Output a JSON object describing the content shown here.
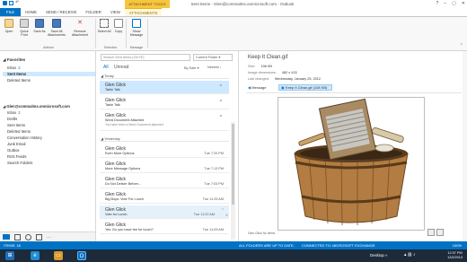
{
  "window": {
    "title": "Sent Items - Glen@commalms.onmicrosoft.com - Outlook",
    "context_header": "ATTACHMENT TOOLS"
  },
  "ribbon_tabs": [
    "FILE",
    "HOME",
    "SEND / RECEIVE",
    "FOLDER",
    "VIEW",
    "ATTACHMENTS"
  ],
  "ribbon": {
    "buttons": [
      {
        "label": "Open",
        "icon": "open-icon"
      },
      {
        "label": "Quick Print",
        "icon": "print-icon"
      },
      {
        "label": "Save As",
        "icon": "save-as-icon"
      },
      {
        "label": "Save All Attachments",
        "icon": "save-all-icon"
      },
      {
        "label": "Remove Attachment",
        "icon": "remove-attachment-icon"
      },
      {
        "label": "Select All",
        "icon": "select-all-icon"
      },
      {
        "label": "Copy",
        "icon": "copy-icon"
      },
      {
        "label": "Show Message",
        "icon": "show-message-icon"
      }
    ],
    "groups": [
      "Actions",
      "Selection",
      "Message"
    ]
  },
  "folders": {
    "favorites_label": "Favorites",
    "favorites": [
      {
        "label": "Inbox",
        "count": "2"
      },
      {
        "label": "Sent Items",
        "count": ""
      },
      {
        "label": "Deleted Items",
        "count": ""
      }
    ],
    "account_label": "Glen@commalms.onmicrosoft.com",
    "account_folders": [
      {
        "label": "Inbox",
        "count": "2"
      },
      {
        "label": "Drafts",
        "count": ""
      },
      {
        "label": "Sent Items",
        "count": ""
      },
      {
        "label": "Deleted Items",
        "count": ""
      },
      {
        "label": "Conversation History",
        "count": ""
      },
      {
        "label": "Junk Email",
        "count": ""
      },
      {
        "label": "Outbox",
        "count": ""
      },
      {
        "label": "RSS Feeds",
        "count": ""
      },
      {
        "label": "Search Folders",
        "count": ""
      }
    ]
  },
  "message_list": {
    "search_placeholder": "Search Sent Items (Ctrl+E)",
    "search_scope": "Current Folder",
    "filter_all": "All",
    "filter_unread": "Unread",
    "sort_by": "By Date",
    "sort_dir": "Newest",
    "groups": [
      {
        "label": "Today",
        "messages": [
          {
            "from": "Glen Glick",
            "subject": "Table Talk",
            "preview": "",
            "time": "",
            "attachment": true
          },
          {
            "from": "Glen Glick",
            "subject": "Table Talk",
            "preview": "",
            "time": "",
            "attachment": true
          },
          {
            "from": "Glen Glick",
            "subject": "Word Document Attached",
            "preview": "You have been a Word Document attached.",
            "time": "",
            "attachment": true
          }
        ]
      },
      {
        "label": "Yesterday",
        "messages": [
          {
            "from": "Glen Glick",
            "subject": "Even More Options",
            "preview": "",
            "time": "Tue 7:20 PM",
            "attachment": false
          },
          {
            "from": "Glen Glick",
            "subject": "More Message Options",
            "preview": "",
            "time": "Tue 7:13 PM",
            "attachment": false
          },
          {
            "from": "Glen Glick",
            "subject": "Do Not Deliver Before...",
            "preview": "",
            "time": "Tue 7:03 PM",
            "attachment": false
          },
          {
            "from": "Glen Glick",
            "subject": "Big Boys: Vote For Lunch",
            "preview": "",
            "time": "Tue 11:25 AM",
            "attachment": false
          },
          {
            "from": "Glen Glick",
            "subject": "Vote for Lunch",
            "preview": "",
            "time": "Tue 11:22 AM",
            "attachment": false
          },
          {
            "from": "Glen Glick",
            "subject": "Yes: Do you have tee for lunch?",
            "preview": "",
            "time": "Tue 11:09 AM",
            "attachment": false
          }
        ]
      }
    ]
  },
  "reading_pane": {
    "attachment_title": "Keep It Clean.gif",
    "size_label": "Size:",
    "size_value": "108 KB",
    "dimensions_label": "Image dimensions:",
    "dimensions_value": "482 x 415",
    "changed_label": "Last changed:",
    "changed_value": "Wednesday, January 25, 2012",
    "back_label": "Message",
    "file_chip": "Keep It Clean.gif (108 KB)",
    "footer_name": "Glen Glick",
    "footer_extra": "No Items"
  },
  "statusbar": {
    "items": "ITEMS: 18",
    "folders_status": "ALL FOLDERS ARE UP TO DATE.",
    "connection": "CONNECTED TO: MICROSOFT EXCHANGE",
    "zoom": "100%"
  },
  "taskbar": {
    "desktop_label": "Desktop",
    "time": "12:37 PM",
    "date": "12/4/2013"
  },
  "colors": {
    "accent": "#0072c6",
    "context_tab": "#f7c540",
    "selection": "#cde8ff",
    "taskbar": "#1c2a3a"
  }
}
